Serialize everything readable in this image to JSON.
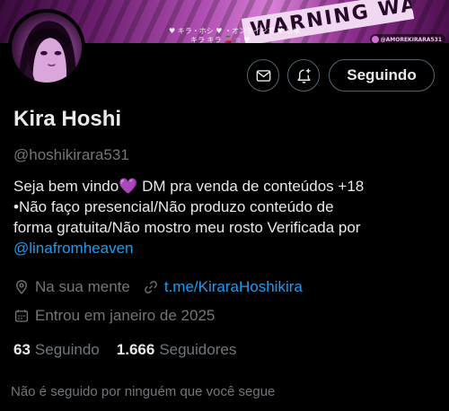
{
  "banner": {
    "tape_text": "WARNING WA",
    "jp_line1": "♥ キラ・ホシ ♥ ・オンラインで ♥ 日本",
    "jp_line2": "キラ キラ 🍒 ☆ ♥",
    "telegram_tag": "@AMOREKIRARA531"
  },
  "profile": {
    "name": "Kira Hoshi",
    "handle": "@hoshikirara531",
    "follow_button_label": "Seguindo",
    "bio": {
      "line1_text": "Seja bem vindo",
      "line1_heart": "💜",
      "line1_rest": " DM pra venda de conteúdos +18",
      "line2": "•Não faço presencial/Não produzo conteúdo de",
      "line3": "forma gratuita/Não mostro meu rosto Verificada por",
      "mention": "@linafromheaven"
    },
    "location": "Na sua mente",
    "website": "t.me/KiraraHoshikira",
    "joined": "Entrou em janeiro de 2025",
    "following_count": "63",
    "following_label": "Seguindo",
    "followers_count": "1.666",
    "followers_label": "Seguidores",
    "mutuals_notice": "Não é seguido por ninguém que você segue"
  },
  "icons": {
    "message": "envelope-icon",
    "notify": "bell-plus-icon",
    "location": "location-pin-icon",
    "website": "link-icon",
    "joined": "calendar-icon"
  },
  "colors": {
    "accent_link": "#1d9bf0",
    "muted_text": "#71767b",
    "primary_text": "#e7e9ea",
    "button_border": "#536471"
  }
}
